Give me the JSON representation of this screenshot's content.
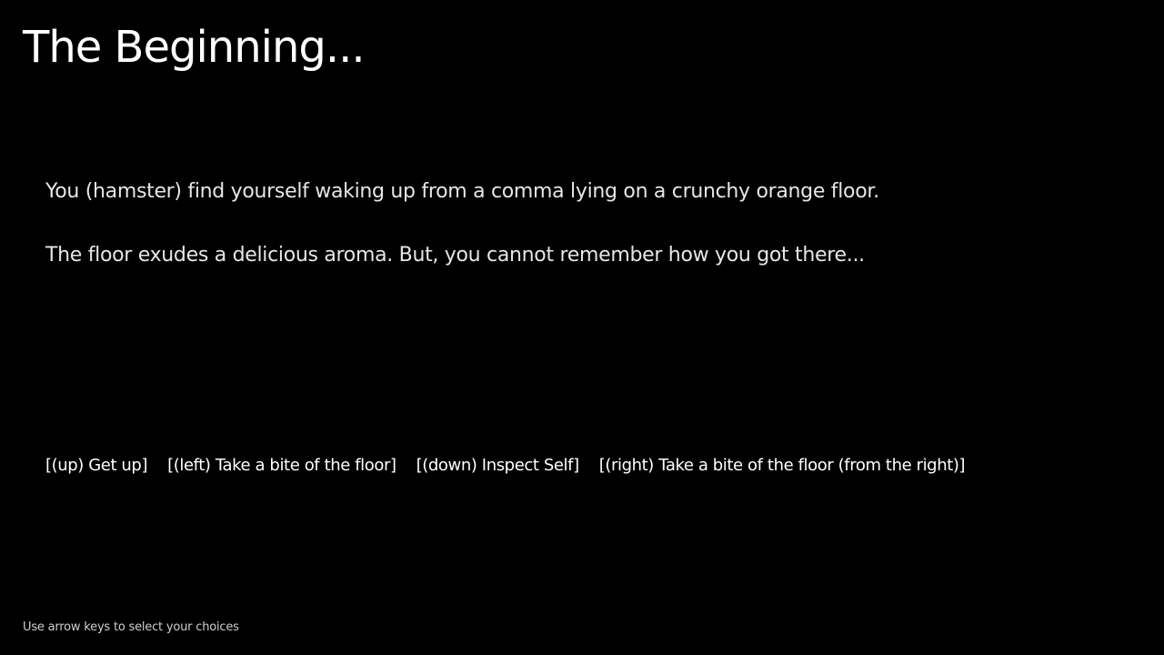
{
  "scene": {
    "title": "The Beginning..."
  },
  "story": {
    "paragraphs": [
      "You (hamster) find yourself waking up from a comma lying on a crunchy orange floor.",
      "The floor exudes a delicious aroma. But, you cannot remember how you got there..."
    ]
  },
  "choices": [
    {
      "key": "up",
      "label": "[(up) Get up]"
    },
    {
      "key": "left",
      "label": "[(left) Take a bite of the floor]"
    },
    {
      "key": "down",
      "label": "[(down) Inspect Self]"
    },
    {
      "key": "right",
      "label": "[(right) Take a bite of the floor (from the right)]"
    }
  ],
  "footer": {
    "hint": "Use arrow keys to select your choices"
  },
  "colors": {
    "background": "#000000",
    "text": "#ffffff",
    "story_text": "#e6e6e6",
    "hint_text": "#cfcfcf"
  }
}
